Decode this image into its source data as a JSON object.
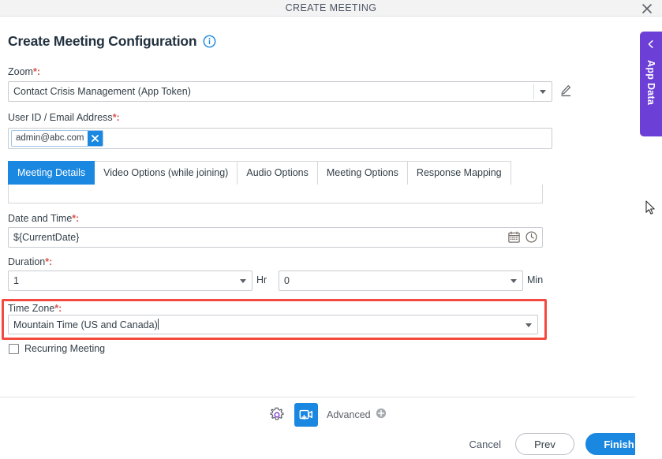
{
  "window": {
    "title": "CREATE MEETING",
    "close_icon": "close-icon"
  },
  "page": {
    "heading": "Create Meeting Configuration",
    "info_icon": "info-icon"
  },
  "form": {
    "zoom": {
      "label": "Zoom",
      "required_mark": "*:",
      "value": "Contact Crisis Management (App Token)",
      "edit_icon": "pencil-icon"
    },
    "user_id": {
      "label": "User ID / Email Address",
      "required_mark": "*:",
      "chips": [
        {
          "text": "admin@abc.com",
          "remove_icon": "close-icon"
        }
      ]
    },
    "date_time": {
      "label": "Date and Time",
      "required_mark": "*:",
      "value": "${CurrentDate}",
      "calendar_icon": "calendar-icon",
      "clock_icon": "clock-icon"
    },
    "duration": {
      "label": "Duration",
      "required_mark": "*:",
      "hours_value": "1",
      "hours_unit": "Hr",
      "minutes_value": "0",
      "minutes_unit": "Min"
    },
    "time_zone": {
      "label": "Time Zone",
      "required_mark": "*:",
      "value": "Mountain Time (US and Canada)",
      "highlight_color": "#f4493f",
      "focused": true
    },
    "recurring_meeting": {
      "label": "Recurring Meeting",
      "checked": false
    }
  },
  "tabs": [
    {
      "label": "Meeting Details",
      "active": true
    },
    {
      "label": "Video Options (while joining)",
      "active": false
    },
    {
      "label": "Audio Options",
      "active": false
    },
    {
      "label": "Meeting Options",
      "active": false
    },
    {
      "label": "Response Mapping",
      "active": false
    }
  ],
  "toolbar": {
    "settings_icon": "gear-icon",
    "video_icon": "add-video-meeting-icon",
    "advanced_label": "Advanced",
    "advanced_add_icon": "plus-circle-icon"
  },
  "buttons": {
    "cancel": "Cancel",
    "prev": "Prev",
    "finish": "Finish"
  },
  "side_panel": {
    "label": "App Data",
    "collapse_icon": "chevron-left-icon",
    "color": "#6c3fd6"
  },
  "colors": {
    "accent_blue": "#1a87e0",
    "highlight_red": "#f4493f",
    "purple": "#6c3fd6",
    "titlebar_bg": "#f3f3f4",
    "text": "#333f48",
    "required_red": "#d9534f"
  }
}
